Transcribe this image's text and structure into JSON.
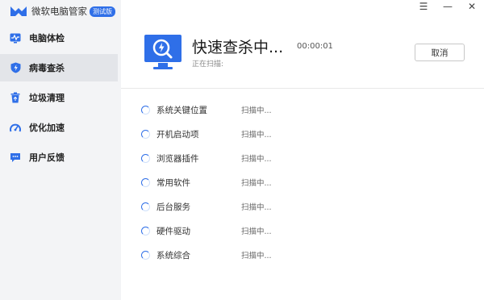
{
  "app": {
    "name": "微软电脑管家",
    "badge": "测试版"
  },
  "window_controls": [
    {
      "name": "menu-button",
      "glyph": "☰"
    },
    {
      "name": "minimize-button",
      "glyph": "—"
    },
    {
      "name": "close-button",
      "glyph": "✕"
    }
  ],
  "sidebar": {
    "items": [
      {
        "label": "电脑体检",
        "icon": "pulse-icon",
        "active": false
      },
      {
        "label": "病毒查杀",
        "icon": "shield-icon",
        "active": true
      },
      {
        "label": "垃圾清理",
        "icon": "recycle-bin-icon",
        "active": false
      },
      {
        "label": "优化加速",
        "icon": "speedometer-icon",
        "active": false
      },
      {
        "label": "用户反馈",
        "icon": "chat-icon",
        "active": false
      }
    ]
  },
  "scan": {
    "title": "快速查杀中...",
    "subtitle": "正在扫描:",
    "elapsed": "00:00:01",
    "cancel_label": "取消",
    "items": [
      {
        "name": "系统关键位置",
        "status": "扫描中..."
      },
      {
        "name": "开机启动项",
        "status": "扫描中..."
      },
      {
        "name": "浏览器插件",
        "status": "扫描中..."
      },
      {
        "name": "常用软件",
        "status": "扫描中..."
      },
      {
        "name": "后台服务",
        "status": "扫描中..."
      },
      {
        "name": "硬件驱动",
        "status": "扫描中..."
      },
      {
        "name": "系统综合",
        "status": "扫描中..."
      }
    ]
  },
  "colors": {
    "accent": "#2f6fe8",
    "sidebar_bg": "#f3f4f6",
    "active_bg": "#e3e5e9"
  }
}
